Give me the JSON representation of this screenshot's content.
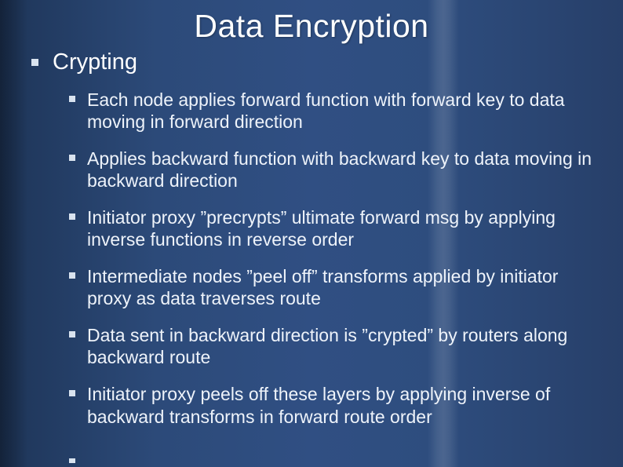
{
  "title": "Data Encryption",
  "level1": {
    "text": "Crypting"
  },
  "level2": [
    {
      "text": "Each node applies forward function with forward key to data moving in forward direction"
    },
    {
      "text": "Applies backward function with backward key to data moving in backward direction"
    },
    {
      "text": "Initiator proxy ”precrypts” ultimate forward msg by applying inverse functions in reverse order"
    },
    {
      "text": "Intermediate nodes ”peel off” transforms applied by initiator proxy as data traverses route"
    },
    {
      "text": "Data sent in backward direction is ”crypted” by routers along backward route"
    },
    {
      "text": "Initiator proxy peels off these layers by applying inverse of backward transforms in forward route order"
    }
  ]
}
